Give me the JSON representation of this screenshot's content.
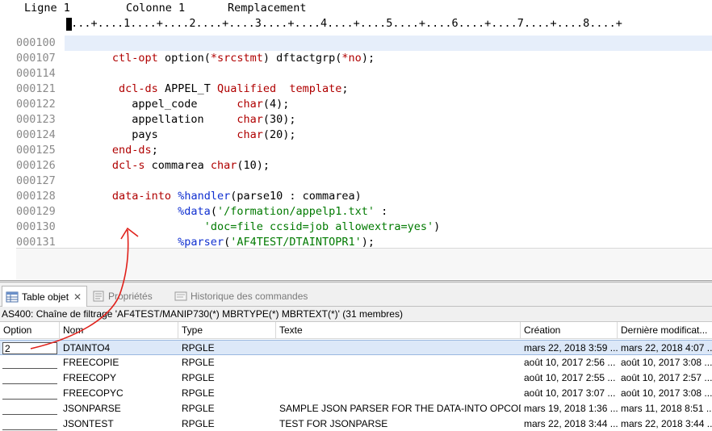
{
  "status": {
    "ligne": "Ligne 1",
    "colonne": "Colonne 1",
    "mode": "Remplacement"
  },
  "ruler": "....+....1....+....2....+....3....+....4....+....5....+....6....+....7....+....8....+",
  "code_lines": [
    {
      "num": "000100",
      "text": ""
    },
    {
      "num": "000107",
      "text": "       ctl-opt option(*srcstmt) dftactgrp(*no);"
    },
    {
      "num": "000114",
      "text": ""
    },
    {
      "num": "000121",
      "text": "        dcl-ds APPEL_T Qualified  template;"
    },
    {
      "num": "000122",
      "text": "          appel_code      char(4);"
    },
    {
      "num": "000123",
      "text": "          appellation     char(30);"
    },
    {
      "num": "000124",
      "text": "          pays            char(20);"
    },
    {
      "num": "000125",
      "text": "       end-ds;"
    },
    {
      "num": "000126",
      "text": "       dcl-s commarea char(10);"
    },
    {
      "num": "000127",
      "text": ""
    },
    {
      "num": "000128",
      "text": "       data-into %handler(parse10 : commarea)"
    },
    {
      "num": "000129",
      "text": "                 %data('/formation/appelp1.txt' :"
    },
    {
      "num": "000130",
      "text": "                     'doc=file ccsid=job allowextra=yes')"
    },
    {
      "num": "000131",
      "text": "                 %parser('AF4TEST/DTAINTOPR1');"
    }
  ],
  "tabs": [
    {
      "label": "Table objet",
      "icon": "table-icon",
      "active": true
    },
    {
      "label": "Propriétés",
      "icon": "properties-icon",
      "active": false
    },
    {
      "label": "Historique des commandes",
      "icon": "history-icon",
      "active": false
    }
  ],
  "filter_text": "AS400: Chaîne de filtrage 'AF4TEST/MANIP730(*) MBRTYPE(*) MBRTEXT(*)' (31 membres)",
  "table": {
    "columns": [
      "Option",
      "Nom",
      "Type",
      "Texte",
      "Création",
      "Dernière modificat..."
    ],
    "rows": [
      {
        "option": "2",
        "nom": "DTAINTO4",
        "type": "RPGLE",
        "texte": "",
        "creation": "mars 22, 2018 3:59 ...",
        "modif": "mars 22, 2018 4:07 ..."
      },
      {
        "option": "",
        "nom": "FREECOPIE",
        "type": "RPGLE",
        "texte": "",
        "creation": "août 10, 2017 2:56 ...",
        "modif": "août 10, 2017 3:08 ..."
      },
      {
        "option": "",
        "nom": "FREECOPY",
        "type": "RPGLE",
        "texte": "",
        "creation": "août 10, 2017 2:55 ...",
        "modif": "août 10, 2017 2:57 ..."
      },
      {
        "option": "",
        "nom": "FREECOPYC",
        "type": "RPGLE",
        "texte": "",
        "creation": "août 10, 2017 3:07 ...",
        "modif": "août 10, 2017 3:08 ..."
      },
      {
        "option": "",
        "nom": "JSONPARSE",
        "type": "RPGLE",
        "texte": "SAMPLE JSON PARSER FOR THE DATA-INTO OPCODE",
        "creation": "mars 19, 2018 1:36 ...",
        "modif": "mars 11, 2018 8:51 ..."
      },
      {
        "option": "",
        "nom": "JSONTEST",
        "type": "RPGLE",
        "texte": "TEST FOR JSONPARSE",
        "creation": "mars 22, 2018 3:44 ...",
        "modif": "mars 22, 2018 3:44 ..."
      }
    ]
  },
  "colors": {
    "keyword": "#b00000",
    "builtin": "#1030d0",
    "string": "#007a00",
    "line_number": "#8a8a8a",
    "current_line": "#e6eefa",
    "selected_row": "#dce8f8",
    "annotation": "#e0201a"
  }
}
